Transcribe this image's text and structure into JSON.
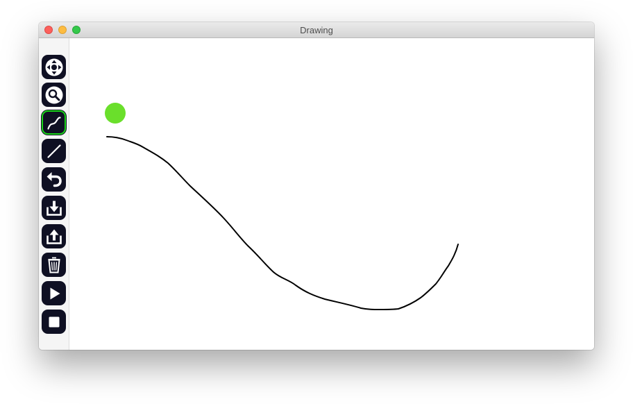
{
  "window": {
    "title": "Drawing"
  },
  "toolbar": {
    "selected_tool": "curve",
    "tools": [
      {
        "name": "pan",
        "icon": "move-arrows-icon"
      },
      {
        "name": "zoom",
        "icon": "magnifier-icon"
      },
      {
        "name": "curve",
        "icon": "freehand-curve-icon"
      },
      {
        "name": "line",
        "icon": "straight-line-icon"
      },
      {
        "name": "undo",
        "icon": "undo-arrow-icon"
      },
      {
        "name": "import",
        "icon": "download-tray-icon"
      },
      {
        "name": "export",
        "icon": "upload-tray-icon"
      },
      {
        "name": "clear",
        "icon": "trash-icon"
      },
      {
        "name": "play",
        "icon": "play-icon"
      },
      {
        "name": "stop",
        "icon": "stop-icon"
      }
    ]
  },
  "canvas": {
    "marker_color": "#6adf2b",
    "stroke_color": "#000000"
  },
  "colors": {
    "tool_background": "#0f1023",
    "selection_highlight": "#19d419"
  }
}
